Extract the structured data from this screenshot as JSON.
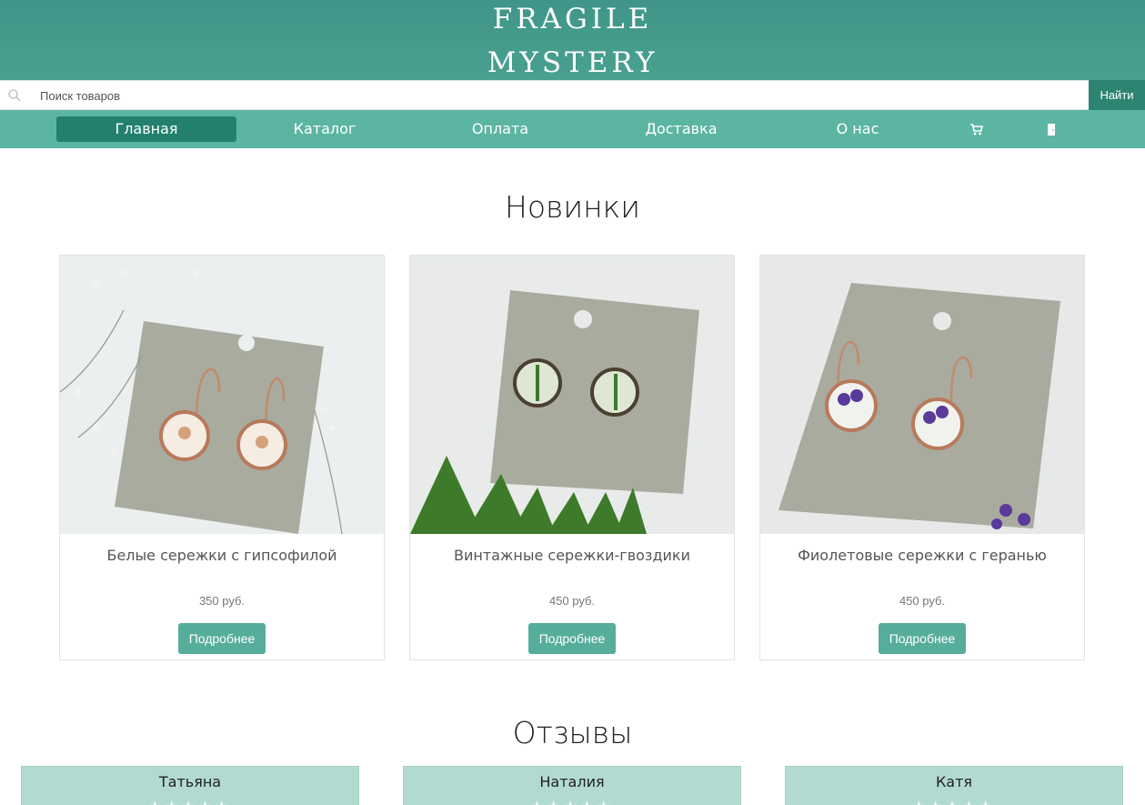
{
  "brand": {
    "line1": "FRAGILE",
    "line2": "MYSTERY"
  },
  "search": {
    "placeholder": "Поиск товаров",
    "button": "Найти"
  },
  "nav": {
    "items": [
      "Главная",
      "Каталог",
      "Оплата",
      "Доставка",
      "О нас"
    ],
    "active": "Главная",
    "icons": [
      "cart-icon",
      "door-exit-icon"
    ]
  },
  "new_section": {
    "title": "Новинки",
    "products": [
      {
        "name": "Белые сережки с гипсофилой",
        "price": "350 руб.",
        "button": "Подробнее"
      },
      {
        "name": "Винтажные сережки-гвоздики",
        "price": "450 руб.",
        "button": "Подробнее"
      },
      {
        "name": "Фиолетовые сережки с геранью",
        "price": "450 руб.",
        "button": "Подробнее"
      }
    ]
  },
  "reviews_section": {
    "title": "Отзывы",
    "reviews": [
      {
        "name": "Татьяна",
        "stars": "★★★★★"
      },
      {
        "name": "Наталия",
        "stars": "★★★★★"
      },
      {
        "name": "Катя",
        "stars": "★★★★★"
      }
    ]
  },
  "colors": {
    "header": "#459a8b",
    "nav": "#5cb5a3",
    "nav_active": "#23806e",
    "button": "#56ad9c",
    "review_bg": "#b3dad1"
  }
}
